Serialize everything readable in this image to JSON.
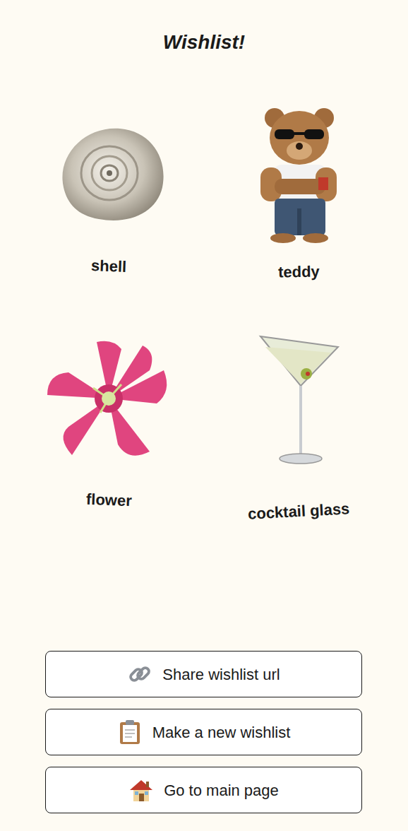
{
  "title": "Wishlist!",
  "items": [
    {
      "label": "shell"
    },
    {
      "label": "teddy"
    },
    {
      "label": "flower"
    },
    {
      "label": "cocktail glass"
    }
  ],
  "buttons": [
    {
      "label": "Share wishlist url"
    },
    {
      "label": "Make a new wishlist"
    },
    {
      "label": "Go to main page"
    }
  ]
}
